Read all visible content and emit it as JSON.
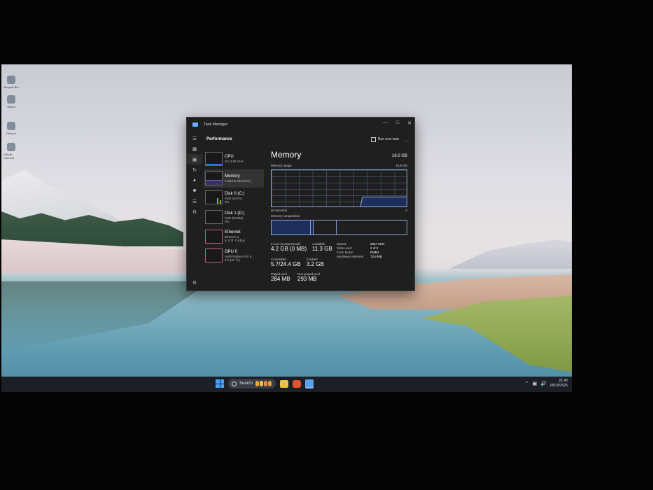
{
  "desktop": {
    "icons": [
      "Recycle Bin",
      "Steam",
      "Discord",
      "Ubisoft Connect"
    ]
  },
  "taskbar": {
    "search_placeholder": "Search",
    "time": "21:48",
    "date": "09/10/2025"
  },
  "task_manager": {
    "title": "Task Manager",
    "page_title": "Performance",
    "run_new_task": "Run new task",
    "more": "…",
    "items": [
      {
        "name": "CPU",
        "sub1": "2% 3.96 GHz",
        "sub2": "",
        "color": "#2b75d8"
      },
      {
        "name": "Memory",
        "sub1": "4.6/15.8 GB (29%)",
        "sub2": "",
        "color": "#7b61c4"
      },
      {
        "name": "Disk 0 (C:)",
        "sub1": "SSD (SATA)",
        "sub2": "0%",
        "color": "#7dbb3a"
      },
      {
        "name": "Disk 1 (D:)",
        "sub1": "SSD (NVMe)",
        "sub2": "0%",
        "color": "#7dbb3a"
      },
      {
        "name": "Ethernet",
        "sub1": "Ethernet 2",
        "sub2": "S: 0 R: 0 Kbps",
        "color": "#c75a8a"
      },
      {
        "name": "GPU 0",
        "sub1": "AMD Radeon RX 6...",
        "sub2": "1% (32 °C)",
        "color": "#c75a8a"
      }
    ],
    "memory": {
      "title": "Memory",
      "total": "16.0 GB",
      "usage_label": "Memory usage",
      "usage_max": "15.9 GB",
      "time_label": "60 seconds",
      "zero": "0",
      "composition_label": "Memory composition",
      "usage_percent": 29,
      "stats": {
        "in_use_label": "In use (Compressed)",
        "in_use": "4.2 GB (0 MB)",
        "available_label": "Available",
        "available": "11.3 GB",
        "committed_label": "Committed",
        "committed": "5.7/24.4 GB",
        "cached_label": "Cached",
        "cached": "3.2 GB",
        "paged_label": "Paged pool",
        "paged": "284 MB",
        "nonpaged_label": "Non-paged pool",
        "nonpaged": "293 MB"
      },
      "right_stats": [
        {
          "k": "Speed:",
          "v": "2667 MHz"
        },
        {
          "k": "Slots used:",
          "v": "2 of 2"
        },
        {
          "k": "Form factor:",
          "v": "DIMM"
        },
        {
          "k": "Hardware reserved:",
          "v": "73.9 MB"
        }
      ]
    }
  }
}
